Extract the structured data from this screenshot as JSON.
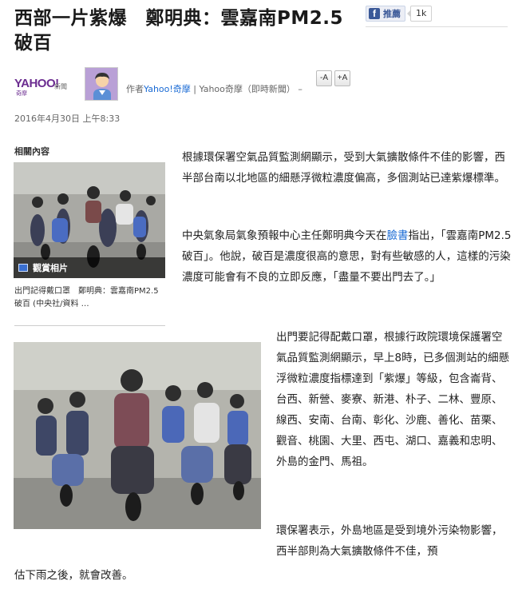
{
  "article": {
    "title": "西部一片紫爆　鄭明典：雲嘉南PM2.5破百",
    "date": "2016年4月30日 上午8:33"
  },
  "facebook": {
    "like_label": "推薦",
    "count": "1k",
    "icon": "facebook-icon"
  },
  "byline": {
    "logo_text": "YAHOO!",
    "logo_sub": "奇摩",
    "logo_news": "新聞",
    "author_prefix": "作者",
    "author_link": "Yahoo!奇摩",
    "author_rest": " | Yahoo奇摩（即時新聞） –",
    "font_smaller": "-A",
    "font_larger": "+A"
  },
  "related": {
    "heading": "相關內容",
    "gallery_label": "觀賞相片",
    "caption": "出門記得戴口罩　鄭明典：雲嘉南PM2.5破百 (中央社/資料 …"
  },
  "body": {
    "p1": "根據環保署空氣品質監測網顯示，受到大氣擴散條件不佳的影響，西半部台南以北地區的細懸浮微粒濃度偏高，多個測站已達紫爆標準。",
    "p2_before": "中央氣象局氣象預報中心主任鄭明典今天在",
    "p2_link": "臉書",
    "p2_after": "指出，「雲嘉南PM2.5破百」。他說，破百是濃度很高的意思，對有些敏感的人，這樣的污染濃度可能會有不良的立即反應，「盡量不要出門去了。」",
    "p3": "出門要記得配戴口罩，根據行政院環境保護署空氣品質監測網顯示，早上8時，已多個測站的細懸浮微粒濃度指標達到「紫爆」等級，包含崙背、台西、新營、麥寮、新港、朴子、二林、豐原、線西、安南、台南、彰化、沙鹿、善化、苗栗、觀音、桃園、大里、西屯、湖口、嘉義和忠明、外島的金門、馬祖。",
    "p4": "環保署表示，外島地區是受到境外污染物影響，西半部則為大氣擴散條件不佳，預",
    "p5": "估下雨之後，就會改善。"
  }
}
